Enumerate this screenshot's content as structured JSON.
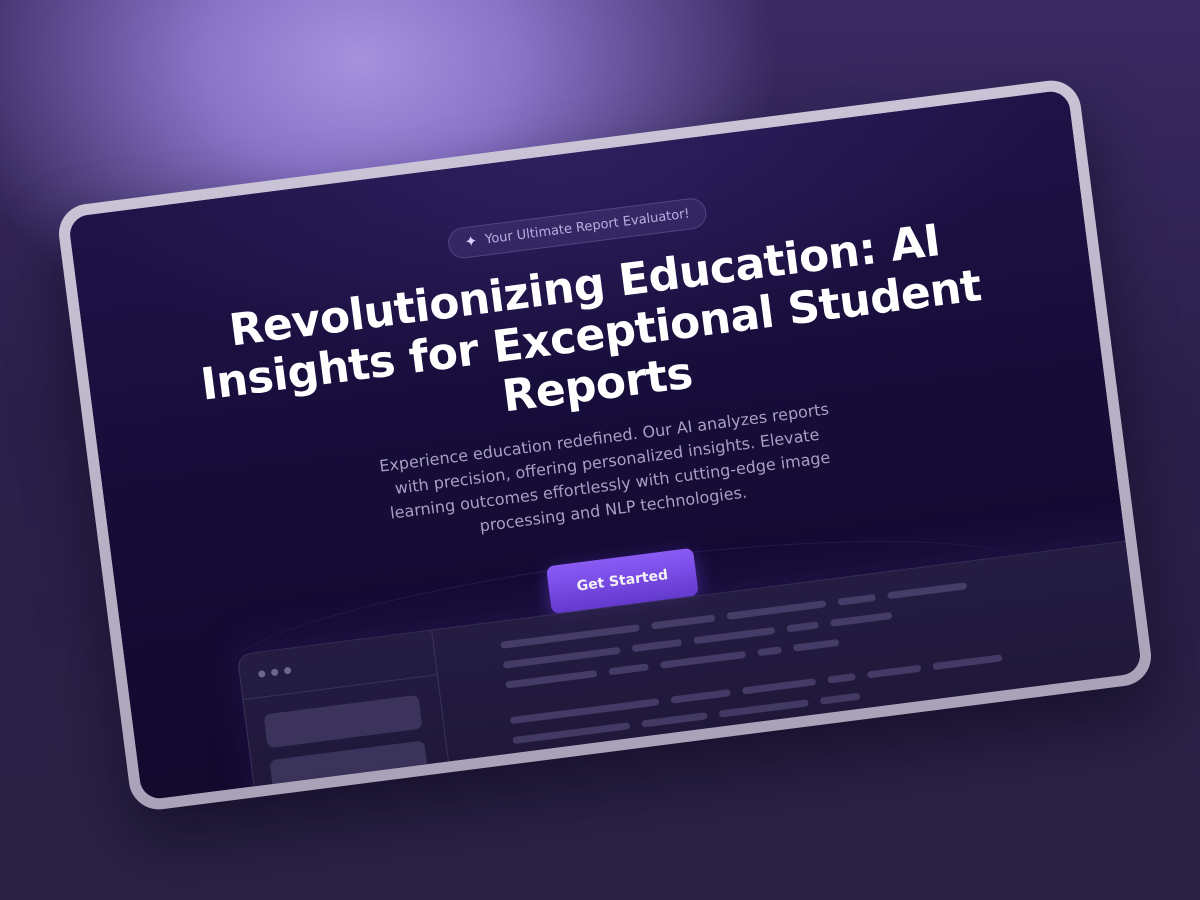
{
  "hero": {
    "badge_icon": "sparkle-icon",
    "badge_text": "Your Ultimate Report Evaluator!",
    "headline": "Revolutionizing Education: AI Insights for Exceptional Student Reports",
    "subheadline": "Experience education redefined. Our AI analyzes reports with precision, offering personalized insights. Elevate learning outcomes effortlessly with cutting-edge image processing and NLP technologies.",
    "cta_label": "Get Started"
  },
  "colors": {
    "accent": "#7c4dff",
    "background": "#160c38",
    "frame": "#bdb6cc"
  }
}
